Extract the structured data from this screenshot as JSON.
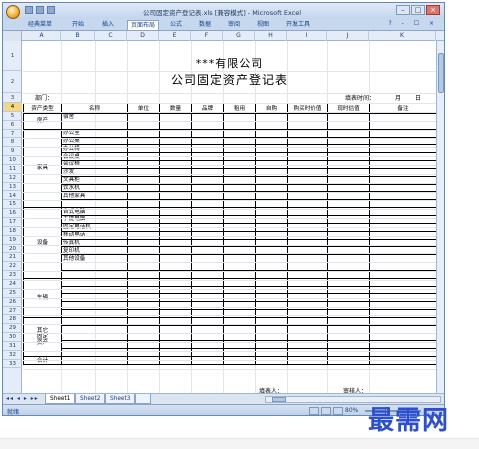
{
  "window": {
    "title": "公司固定资产登记表.xls [兼容模式] - Microsoft Excel",
    "controls": [
      "–",
      "□",
      "×"
    ]
  },
  "ribbon": {
    "tabs": [
      "经典菜单",
      "开始",
      "插入",
      "页面布局",
      "公式",
      "数据",
      "审阅",
      "视图",
      "开发工具"
    ],
    "active_tab": "页面布局",
    "right_icons": "? - ☐ ×"
  },
  "columns": [
    "A",
    "B",
    "C",
    "D",
    "E",
    "F",
    "G",
    "H",
    "I",
    "J",
    "K"
  ],
  "rows": [
    "1",
    "2",
    "3",
    "4",
    "5",
    "6",
    "7",
    "8",
    "9",
    "10",
    "11",
    "12",
    "13",
    "14",
    "15",
    "16",
    "17",
    "18",
    "19",
    "20",
    "21",
    "22",
    "23",
    "24",
    "25",
    "26",
    "27",
    "28",
    "29",
    "30",
    "31",
    "32",
    "33"
  ],
  "form": {
    "company": "***有限公司",
    "title": "公司固定资产登记表",
    "dept_label": "部门：",
    "fill_date_label": "填表时间：",
    "month": "月",
    "day": "日",
    "headers": [
      "资产类型",
      "名称",
      "单位",
      "数量",
      "品牌",
      "租用",
      "自购",
      "购买时价值",
      "现时估值",
      "备注"
    ],
    "groups": {
      "house": "房产",
      "furniture": "家具",
      "equipment": "设备",
      "vehicle": "车辆",
      "other": "其它\n固定\n资产",
      "total": "合计"
    },
    "items": {
      "house": [
        "宿舍"
      ],
      "furniture": [
        "办公室",
        "办公桌",
        "办公椅",
        "会议桌",
        "会议椅",
        "沙发",
        "文具柜",
        "饮水机",
        "其他家具"
      ],
      "equipment": [
        "台式电脑",
        "手提电脑",
        "固定电话机",
        "移动电话",
        "传真机",
        "复印机",
        "其他设备"
      ]
    },
    "filler_label": "填表人：",
    "reviewer_label": "审核人：",
    "filler_line": "__________",
    "reviewer_line": "__________"
  },
  "sheet_tabs": [
    "Sheet1",
    "Sheet2",
    "Sheet3"
  ],
  "active_sheet": "Sheet1",
  "status": {
    "ready": "就绪",
    "zoom": "80%"
  },
  "watermark": "最需网"
}
